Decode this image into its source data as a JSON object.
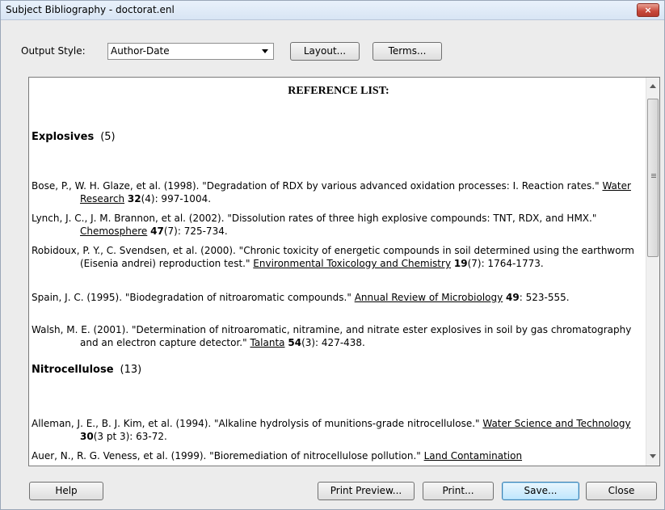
{
  "window": {
    "title": "Subject Bibliography - doctorat.enl",
    "close_label": "×"
  },
  "toolbar": {
    "output_style_label": "Output Style:",
    "output_style_value": "Author-Date",
    "layout_label": "Layout...",
    "terms_label": "Terms..."
  },
  "content": {
    "heading": "REFERENCE LIST:",
    "sections": [
      {
        "title": "Explosives",
        "count": "(5)",
        "refs": [
          {
            "pre": "Bose, P., W. H. Glaze, et al. (1998). \"Degradation of RDX by various advanced oxidation processes: I. Reaction rates.\" ",
            "journal": "Water Research",
            "vol": "32",
            "post": "(4): 997-1004."
          },
          {
            "pre": "Lynch, J. C., J. M. Brannon, et al. (2002). \"Dissolution rates of three high explosive compounds: TNT, RDX, and HMX.\" ",
            "journal": "Chemosphere",
            "vol": "47",
            "post": "(7): 725-734."
          },
          {
            "pre": "Robidoux, P. Y., C. Svendsen, et al. (2000). \"Chronic toxicity of energetic compounds in soil determined using the earthworm (Eisenia andrei) reproduction test.\" ",
            "journal": "Environmental Toxicology and Chemistry",
            "vol": "19",
            "post": "(7): 1764-1773."
          },
          {
            "pre": "Spain, J. C. (1995). \"Biodegradation of nitroaromatic compounds.\" ",
            "journal": "Annual Review of Microbiology",
            "vol": "49",
            "post": ": 523-555."
          },
          {
            "pre": "Walsh, M. E. (2001). \"Determination of nitroaromatic, nitramine, and nitrate ester explosives in soil by gas chromatography and an electron capture detector.\" ",
            "journal": "Talanta",
            "vol": "54",
            "post": "(3): 427-438."
          }
        ]
      },
      {
        "title": "Nitrocellulose",
        "count": "(13)",
        "refs": [
          {
            "pre": "Alleman, J. E., B. J. Kim, et al. (1994). \"Alkaline hydrolysis of munitions-grade nitrocellulose.\" ",
            "journal": "Water Science and Technology",
            "vol": "30",
            "post": "(3 pt 3): 63-72."
          },
          {
            "pre": "Auer, N., R. G. Veness, et al. (1999). \"Bioremediation of nitrocellulose pollution.\" ",
            "journal": "Land Contamination",
            "vol": "",
            "post": ""
          }
        ]
      }
    ]
  },
  "footer": {
    "help_label": "Help",
    "print_preview_label": "Print Preview...",
    "print_label": "Print...",
    "save_label": "Save...",
    "close_label": "Close"
  }
}
